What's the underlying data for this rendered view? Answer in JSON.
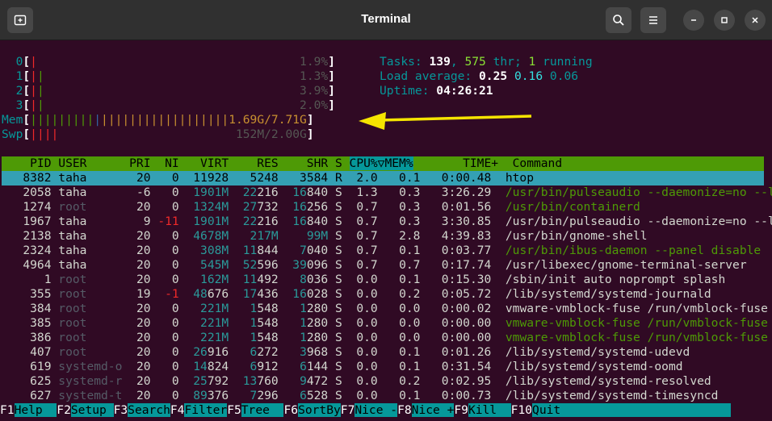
{
  "window": {
    "title": "Terminal"
  },
  "meters": {
    "cpu": [
      {
        "label": "0",
        "bar": "|",
        "bar_color": "red",
        "value": "1.9%"
      },
      {
        "label": "1",
        "bar": "||",
        "bar_color": "mixed",
        "value": "1.3%"
      },
      {
        "label": "2",
        "bar": "||",
        "bar_color": "mixed",
        "value": "3.9%"
      },
      {
        "label": "3",
        "bar": "||",
        "bar_color": "mixed",
        "value": "2.0%"
      }
    ],
    "mem": {
      "label": "Mem",
      "value": "1.69G/7.71G"
    },
    "swp": {
      "label": "Swp",
      "value": "152M/2.00G"
    }
  },
  "summary": {
    "tasks_label": "Tasks:",
    "tasks": "139",
    "thr": "575",
    "thr_label": "thr;",
    "running": "1",
    "running_label": "running",
    "load_label": "Load average:",
    "load1": "0.25",
    "load5": "0.16",
    "load15": "0.06",
    "uptime_label": "Uptime:",
    "uptime": "04:26:21"
  },
  "columns": [
    "PID",
    "USER",
    "PRI",
    "NI",
    "VIRT",
    "RES",
    "SHR",
    "S",
    "CPU%",
    "▽MEM%",
    "TIME+",
    "Command"
  ],
  "processes": [
    {
      "pid": "8382",
      "user": "taha",
      "pri": "20",
      "ni": "0",
      "virt": "11928",
      "res": "5248",
      "shr": "3584",
      "s": "R",
      "cpu": "2.0",
      "mem": "0.1",
      "time": "0:00.48",
      "cmd": "htop"
    },
    {
      "pid": "2058",
      "user": "taha",
      "pri": "-6",
      "ni": "0",
      "virt": "1901M",
      "res": "22216",
      "shr": "16840",
      "s": "S",
      "cpu": "1.3",
      "mem": "0.3",
      "time": "3:26.29",
      "cmd": "/usr/bin/pulseaudio --daemonize=no --log"
    },
    {
      "pid": "1274",
      "user": "root",
      "pri": "20",
      "ni": "0",
      "virt": "1324M",
      "res": "27732",
      "shr": "16256",
      "s": "S",
      "cpu": "0.7",
      "mem": "0.3",
      "time": "0:01.56",
      "cmd": "/usr/bin/containerd"
    },
    {
      "pid": "1967",
      "user": "taha",
      "pri": "9",
      "ni": "-11",
      "virt": "1901M",
      "res": "22216",
      "shr": "16840",
      "s": "S",
      "cpu": "0.7",
      "mem": "0.3",
      "time": "3:30.85",
      "cmd": "/usr/bin/pulseaudio --daemonize=no --log"
    },
    {
      "pid": "2138",
      "user": "taha",
      "pri": "20",
      "ni": "0",
      "virt": "4678M",
      "res": "217M",
      "shr": "99M",
      "s": "S",
      "cpu": "0.7",
      "mem": "2.8",
      "time": "4:39.83",
      "cmd": "/usr/bin/gnome-shell"
    },
    {
      "pid": "2324",
      "user": "taha",
      "pri": "20",
      "ni": "0",
      "virt": "308M",
      "res": "11844",
      "shr": "7040",
      "s": "S",
      "cpu": "0.7",
      "mem": "0.1",
      "time": "0:03.77",
      "cmd": "/usr/bin/ibus-daemon --panel disable"
    },
    {
      "pid": "4964",
      "user": "taha",
      "pri": "20",
      "ni": "0",
      "virt": "545M",
      "res": "52596",
      "shr": "39096",
      "s": "S",
      "cpu": "0.7",
      "mem": "0.7",
      "time": "0:17.74",
      "cmd": "/usr/libexec/gnome-terminal-server"
    },
    {
      "pid": "1",
      "user": "root",
      "pri": "20",
      "ni": "0",
      "virt": "162M",
      "res": "11492",
      "shr": "8036",
      "s": "S",
      "cpu": "0.0",
      "mem": "0.1",
      "time": "0:15.30",
      "cmd": "/sbin/init auto noprompt splash"
    },
    {
      "pid": "355",
      "user": "root",
      "pri": "19",
      "ni": "-1",
      "virt": "48676",
      "res": "17436",
      "shr": "16028",
      "s": "S",
      "cpu": "0.0",
      "mem": "0.2",
      "time": "0:05.72",
      "cmd": "/lib/systemd/systemd-journald"
    },
    {
      "pid": "384",
      "user": "root",
      "pri": "20",
      "ni": "0",
      "virt": "221M",
      "res": "1548",
      "shr": "1280",
      "s": "S",
      "cpu": "0.0",
      "mem": "0.0",
      "time": "0:00.02",
      "cmd": "vmware-vmblock-fuse /run/vmblock-fuse -o"
    },
    {
      "pid": "385",
      "user": "root",
      "pri": "20",
      "ni": "0",
      "virt": "221M",
      "res": "1548",
      "shr": "1280",
      "s": "S",
      "cpu": "0.0",
      "mem": "0.0",
      "time": "0:00.00",
      "cmd": "vmware-vmblock-fuse /run/vmblock-fuse -o"
    },
    {
      "pid": "386",
      "user": "root",
      "pri": "20",
      "ni": "0",
      "virt": "221M",
      "res": "1548",
      "shr": "1280",
      "s": "S",
      "cpu": "0.0",
      "mem": "0.0",
      "time": "0:00.00",
      "cmd": "vmware-vmblock-fuse /run/vmblock-fuse -o"
    },
    {
      "pid": "407",
      "user": "root",
      "pri": "20",
      "ni": "0",
      "virt": "26916",
      "res": "6272",
      "shr": "3968",
      "s": "S",
      "cpu": "0.0",
      "mem": "0.1",
      "time": "0:01.26",
      "cmd": "/lib/systemd/systemd-udevd"
    },
    {
      "pid": "619",
      "user": "systemd-o",
      "pri": "20",
      "ni": "0",
      "virt": "14824",
      "res": "6912",
      "shr": "6144",
      "s": "S",
      "cpu": "0.0",
      "mem": "0.1",
      "time": "0:31.54",
      "cmd": "/lib/systemd/systemd-oomd"
    },
    {
      "pid": "625",
      "user": "systemd-r",
      "pri": "20",
      "ni": "0",
      "virt": "25792",
      "res": "13760",
      "shr": "9472",
      "s": "S",
      "cpu": "0.0",
      "mem": "0.2",
      "time": "0:02.95",
      "cmd": "/lib/systemd/systemd-resolved"
    },
    {
      "pid": "627",
      "user": "systemd-t",
      "pri": "20",
      "ni": "0",
      "virt": "89376",
      "res": "7296",
      "shr": "6528",
      "s": "S",
      "cpu": "0.0",
      "mem": "0.1",
      "time": "0:00.73",
      "cmd": "/lib/systemd/systemd-timesyncd"
    }
  ],
  "fkeys": [
    {
      "key": "F1",
      "label": "Help"
    },
    {
      "key": "F2",
      "label": "Setup"
    },
    {
      "key": "F3",
      "label": "Search"
    },
    {
      "key": "F4",
      "label": "Filter"
    },
    {
      "key": "F5",
      "label": "Tree"
    },
    {
      "key": "F6",
      "label": "SortBy"
    },
    {
      "key": "F7",
      "label": "Nice -"
    },
    {
      "key": "F8",
      "label": "Nice +"
    },
    {
      "key": "F9",
      "label": "Kill"
    },
    {
      "key": "F10",
      "label": "Quit"
    }
  ],
  "colors": {
    "annotation_arrow": "#f5e500",
    "terminal_bg": "#300a24",
    "header_bar": "#4e9a06",
    "selection_bar": "#34a0b4"
  }
}
